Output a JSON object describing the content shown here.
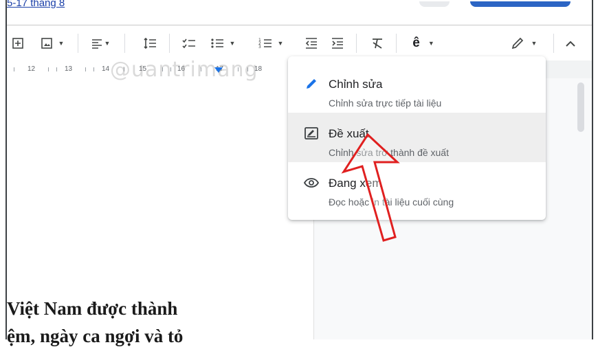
{
  "header": {
    "top_link": "5-17 tháng 8"
  },
  "ruler": {
    "numbers": [
      "12",
      "13",
      "14",
      "15",
      "16",
      "17",
      "18"
    ]
  },
  "watermark": "@uantrimang",
  "mode_menu": {
    "items": [
      {
        "title": "Chỉnh sửa",
        "description": "Chỉnh sửa trực tiếp tài liệu",
        "icon": "pencil-icon",
        "selected": false
      },
      {
        "title": "Đề xuất",
        "description": "Chỉnh sửa trở thành đề xuất",
        "icon": "suggest-icon",
        "selected": false
      },
      {
        "title": "Đang xem",
        "description": "Đọc hoặc in tài liệu cuối cùng",
        "icon": "eye-icon",
        "selected": false
      }
    ]
  },
  "document": {
    "line1": "Việt Nam được thành",
    "line2": "ệm, ngày ca ngợi và tỏ"
  },
  "colors": {
    "accent": "#1a73e8",
    "arrow": "#e02020",
    "menu_highlight": "#eeeeee"
  }
}
